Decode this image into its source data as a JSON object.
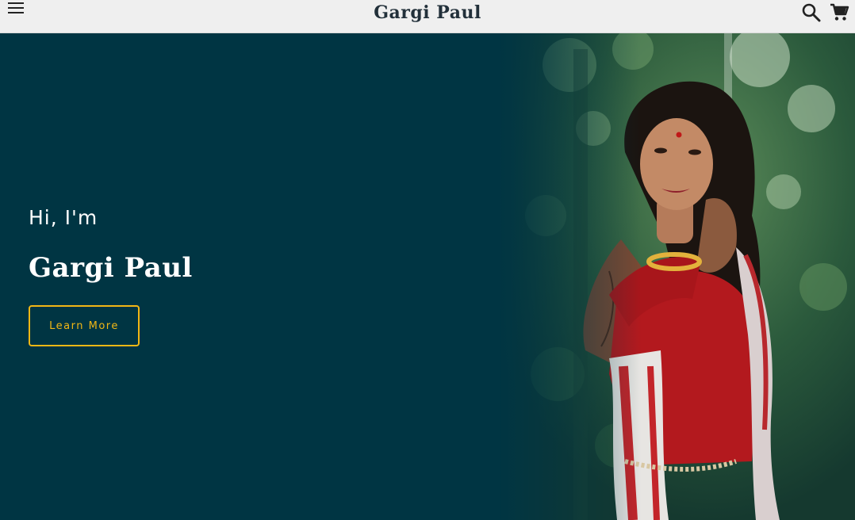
{
  "header": {
    "brand": "Gargi Paul",
    "menu_icon": "hamburger-menu-icon",
    "search_icon": "search-icon",
    "cart_icon": "shopping-cart-icon"
  },
  "hero": {
    "greeting": "Hi, I'm",
    "name": "Gargi Paul",
    "cta_label": "Learn More",
    "photo_icon": "portrait-photo"
  },
  "colors": {
    "background": "#003543",
    "topbar": "#efefef",
    "accent": "#f2b715",
    "text": "#ffffff"
  }
}
